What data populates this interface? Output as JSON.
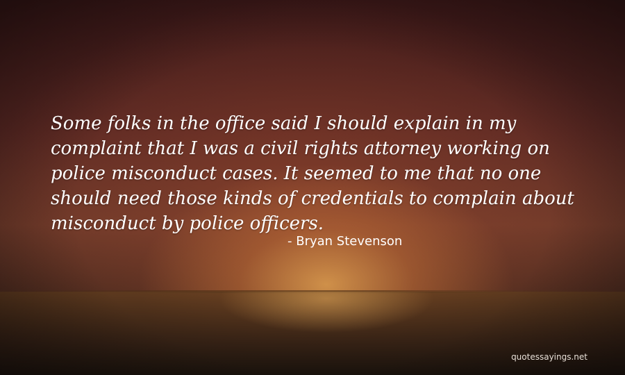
{
  "quote": {
    "lines": [
      "Some folks in the office said I should explain in my",
      "complaint that I was a civil rights attorney working on",
      "police misconduct cases. It seemed to me that no one",
      "should need those kinds of credentials to complain about",
      "misconduct by police officers."
    ],
    "author": "- Bryan Stevenson"
  },
  "watermark": "quotessayings.net",
  "colors": {
    "text": "#ffffff",
    "sky_top": "#3c1818",
    "sun_glow": "#e1a050"
  }
}
